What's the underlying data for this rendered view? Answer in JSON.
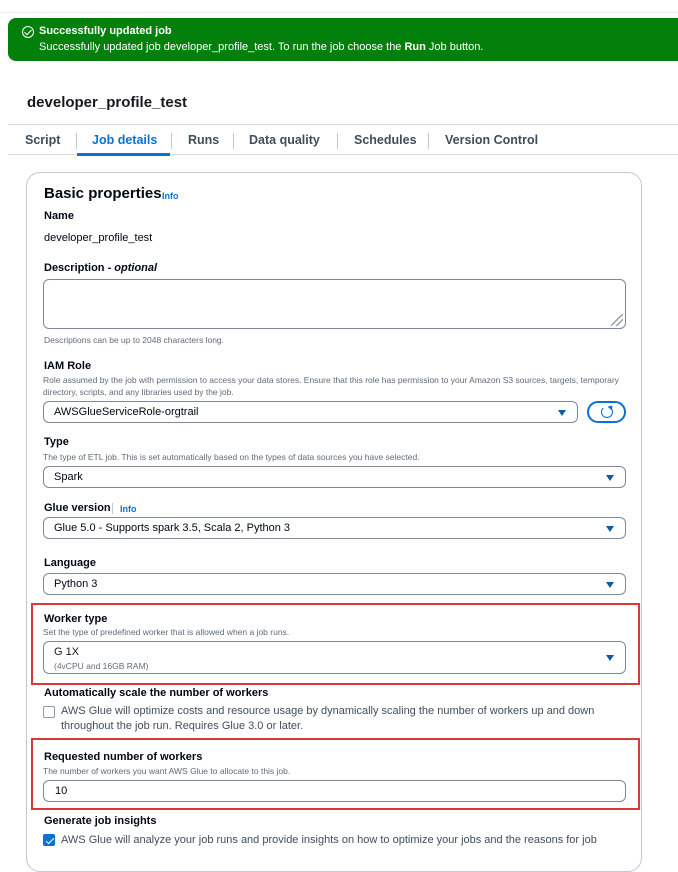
{
  "flash": {
    "title": "Successfully updated job",
    "message_prefix": "Successfully updated job developer_profile_test. To run the job choose the ",
    "message_bold": "Run",
    "message_suffix": " Job button.",
    "color": "#037f0c",
    "icon": "check-circle-icon"
  },
  "page": {
    "title": "developer_profile_test"
  },
  "tabs": [
    "Script",
    "Job details",
    "Runs",
    "Data quality",
    "Schedules",
    "Version Control"
  ],
  "active_tab": "Job details",
  "basic": {
    "heading": "Basic properties",
    "info": "Info",
    "name_label": "Name",
    "name_value": "developer_profile_test",
    "description_label": "Description - ",
    "description_optional": "optional",
    "description_value": "",
    "description_hint": "Descriptions can be up to 2048 characters long.",
    "iam_label": "IAM Role",
    "iam_desc": "Role assumed by the job with permission to access your data stores. Ensure that this role has permission to your Amazon S3 sources, targets, temporary directory, scripts, and any libraries used by the job.",
    "iam_value": "AWSGlueServiceRole-orgtrail",
    "type_label": "Type",
    "type_desc": "The type of ETL job. This is set automatically based on the types of data sources you have selected.",
    "type_value": "Spark",
    "glue_label": "Glue version",
    "glue_info": "Info",
    "glue_value": "Glue 5.0 - Supports spark 3.5, Scala 2, Python 3",
    "language_label": "Language",
    "language_value": "Python 3",
    "worker_type_label": "Worker type",
    "worker_type_desc": "Set the type of predefined worker that is allowed when a job runs.",
    "worker_type_value": "G 1X",
    "worker_type_sub": "(4vCPU and 16GB RAM)",
    "autoscale_label": "Automatically scale the number of workers",
    "autoscale_text": "AWS Glue will optimize costs and resource usage by dynamically scaling the number of workers up and down throughout the job run. Requires Glue 3.0 or later.",
    "autoscale_checked": false,
    "workers_label": "Requested number of workers",
    "workers_desc": "The number of workers you want AWS Glue to allocate to this job.",
    "workers_value": "10",
    "insights_label": "Generate job insights",
    "insights_text": "AWS Glue will analyze your job runs and provide insights on how to optimize your jobs and the reasons for job",
    "insights_checked": true
  },
  "colors": {
    "accent": "#0972d3",
    "highlight": "#d9383a"
  }
}
